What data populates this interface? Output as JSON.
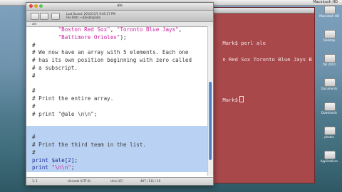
{
  "menubar": {
    "right_text": "Macintosh HD"
  },
  "editor": {
    "title": "ale",
    "toolbar_info": "Last Saved: 2010/11/1 9:05:27 PM\nFile Path: ~/Desktop/ale",
    "tab_label": "ale",
    "code_lines": [
      {
        "parts": [
          {
            "t": "        ",
            "c": "plain"
          },
          {
            "t": "\"Boston Red Sox\"",
            "c": "str"
          },
          {
            "t": ", ",
            "c": "plain"
          },
          {
            "t": "\"Toronto Blue Jays\"",
            "c": "str"
          },
          {
            "t": ",",
            "c": "plain"
          }
        ]
      },
      {
        "parts": [
          {
            "t": "        ",
            "c": "plain"
          },
          {
            "t": "\"Baltimore Orioles\"",
            "c": "str"
          },
          {
            "t": ");",
            "c": "plain"
          }
        ]
      },
      {
        "parts": [
          {
            "t": "#",
            "c": "cmt"
          }
        ]
      },
      {
        "parts": [
          {
            "t": "# We now have an array with 5 elements. Each one",
            "c": "cmt"
          }
        ]
      },
      {
        "parts": [
          {
            "t": "# has its own position beginning with zero called",
            "c": "cmt"
          }
        ]
      },
      {
        "parts": [
          {
            "t": "# a subscript.",
            "c": "cmt"
          }
        ]
      },
      {
        "parts": [
          {
            "t": "#",
            "c": "cmt"
          }
        ]
      },
      {
        "parts": [
          {
            "t": "",
            "c": "plain"
          }
        ]
      },
      {
        "parts": [
          {
            "t": "#",
            "c": "cmt"
          }
        ]
      },
      {
        "parts": [
          {
            "t": "# Print the entire array.",
            "c": "cmt"
          }
        ]
      },
      {
        "parts": [
          {
            "t": "#",
            "c": "cmt"
          }
        ]
      },
      {
        "parts": [
          {
            "t": "# print \"@ale \\n\\n\";",
            "c": "cmt"
          }
        ]
      },
      {
        "parts": [
          {
            "t": "",
            "c": "plain"
          }
        ]
      },
      {
        "parts": [
          {
            "t": "",
            "c": "plain"
          }
        ],
        "hl": true
      },
      {
        "parts": [
          {
            "t": "#",
            "c": "cmt"
          }
        ],
        "hl": true
      },
      {
        "parts": [
          {
            "t": "# Print the third team in the list.",
            "c": "cmt"
          }
        ],
        "hl": true
      },
      {
        "parts": [
          {
            "t": "#",
            "c": "cmt"
          }
        ],
        "hl": true
      },
      {
        "parts": [
          {
            "t": "print ",
            "c": "kw"
          },
          {
            "t": "$ale[2]",
            "c": "var"
          },
          {
            "t": ";",
            "c": "plain"
          }
        ],
        "hl": true
      },
      {
        "parts": [
          {
            "t": "print ",
            "c": "kw"
          },
          {
            "t": "\"\\n\\n\"",
            "c": "str"
          },
          {
            "t": ";",
            "c": "plain"
          }
        ],
        "hl": true
      }
    ],
    "status": {
      "line_col": "1: 1",
      "encoding": "Unicode (UTF-8)",
      "mode": "Unix (LF)",
      "count": "487 / 111 / 19"
    }
  },
  "terminal": {
    "prompt_line": "Mark$ perl ale",
    "output_line": "n Red Sox Toronto Blue Jays B",
    "prompt_line_2": "Mark$"
  },
  "desktop_icons": [
    {
      "label": "Macintosh HD"
    },
    {
      "label": "Desktop"
    },
    {
      "label": "fall 2010"
    },
    {
      "label": "Documents"
    },
    {
      "label": "Downloads"
    },
    {
      "label": "photos"
    },
    {
      "label": "Applications"
    }
  ]
}
